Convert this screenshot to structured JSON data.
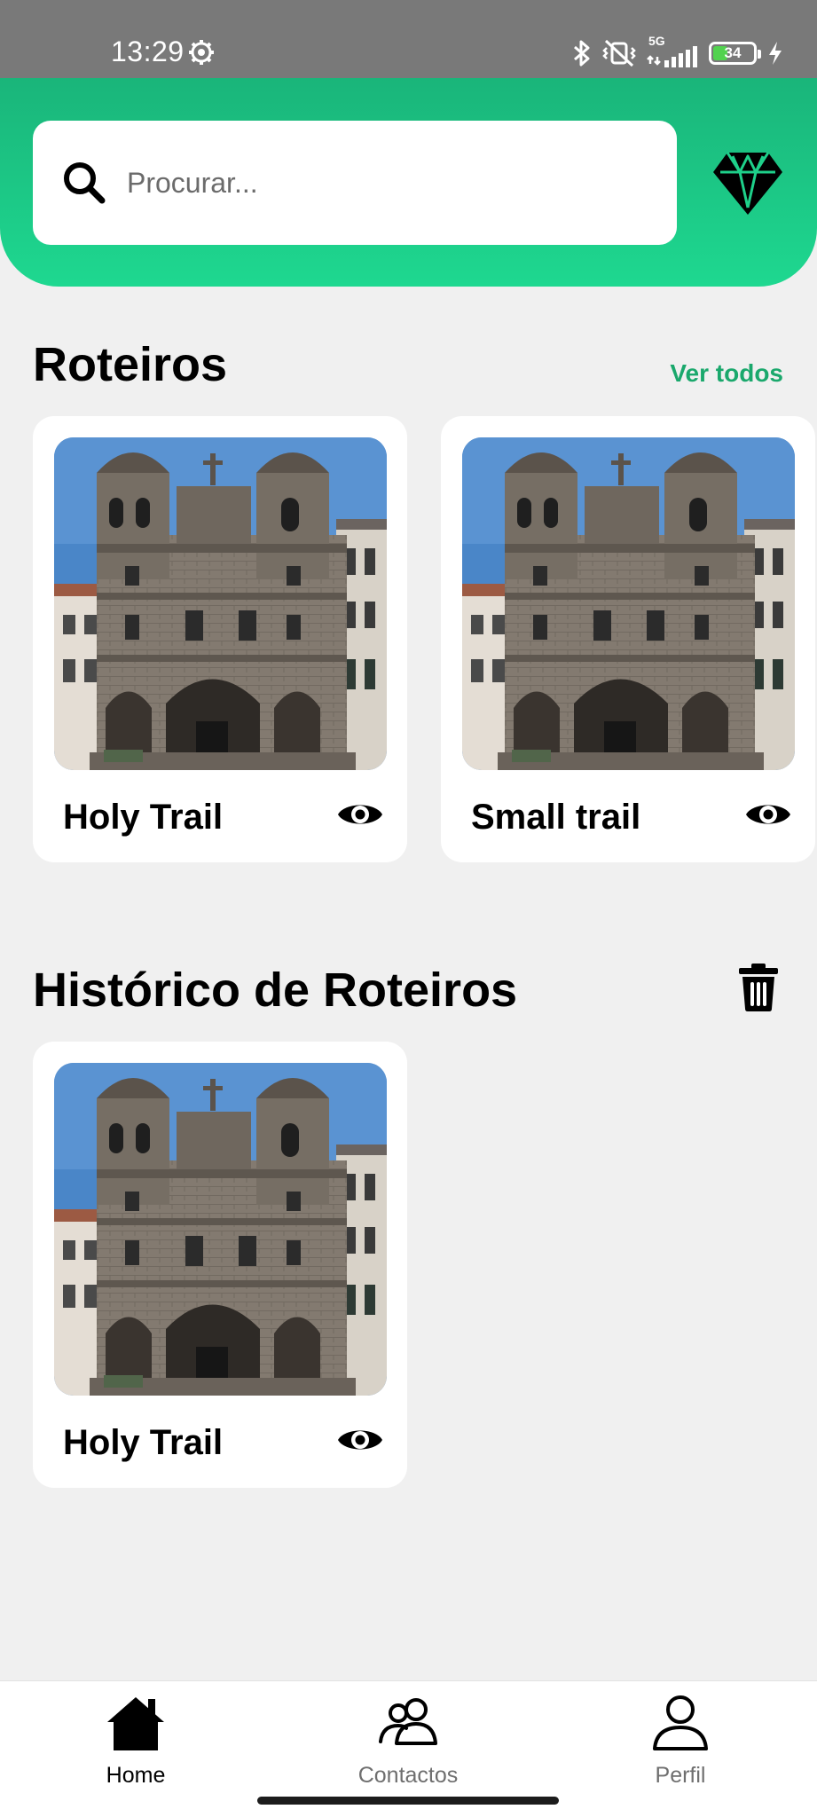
{
  "status_bar": {
    "time": "13:29",
    "network": "5G",
    "battery": "34",
    "icons": [
      "gear-icon",
      "bluetooth-icon",
      "vibrate-off-icon",
      "signal-icon",
      "battery-icon",
      "charging-icon"
    ]
  },
  "search": {
    "placeholder": "Procurar...",
    "value": ""
  },
  "routes": {
    "title": "Roteiros",
    "see_all": "Ver todos",
    "items": [
      {
        "title": "Holy Trail"
      },
      {
        "title": "Small trail"
      }
    ]
  },
  "history": {
    "title": "Histórico de Roteiros",
    "items": [
      {
        "title": "Holy Trail"
      }
    ]
  },
  "nav": {
    "items": [
      {
        "label": "Home",
        "icon": "home-icon",
        "active": true
      },
      {
        "label": "Contactos",
        "icon": "contacts-icon",
        "active": false
      },
      {
        "label": "Perfil",
        "icon": "profile-icon",
        "active": false
      }
    ]
  },
  "colors": {
    "accent": "#1aa86c",
    "header_top": "#1ab57a",
    "header_bottom": "#1ed890",
    "background": "#f0f0f0",
    "nav_active": "#000000",
    "nav_inactive": "#6e6e6e"
  }
}
